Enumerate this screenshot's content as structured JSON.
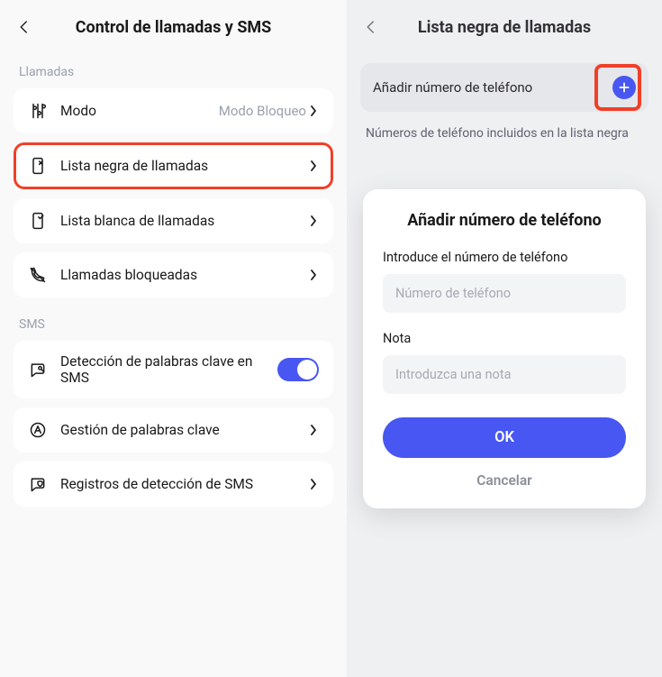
{
  "left": {
    "title": "Control de llamadas y SMS",
    "section_calls": "Llamadas",
    "mode_label": "Modo",
    "mode_value": "Modo Bloqueo",
    "blacklist_label": "Lista negra de llamadas",
    "whitelist_label": "Lista blanca de llamadas",
    "blocked_label": "Llamadas bloqueadas",
    "section_sms": "SMS",
    "sms_detect_label": "Detección de palabras clave en SMS",
    "keywords_label": "Gestión de palabras clave",
    "sms_logs_label": "Registros de detección de SMS"
  },
  "right": {
    "title": "Lista negra de llamadas",
    "add_label": "Añadir número de teléfono",
    "hint": "Números de teléfono incluidos en la lista negra",
    "modal": {
      "title": "Añadir número de teléfono",
      "phone_label": "Introduce el número de teléfono",
      "phone_placeholder": "Número de teléfono",
      "note_label": "Nota",
      "note_placeholder": "Introduzca una nota",
      "ok": "OK",
      "cancel": "Cancelar"
    }
  }
}
